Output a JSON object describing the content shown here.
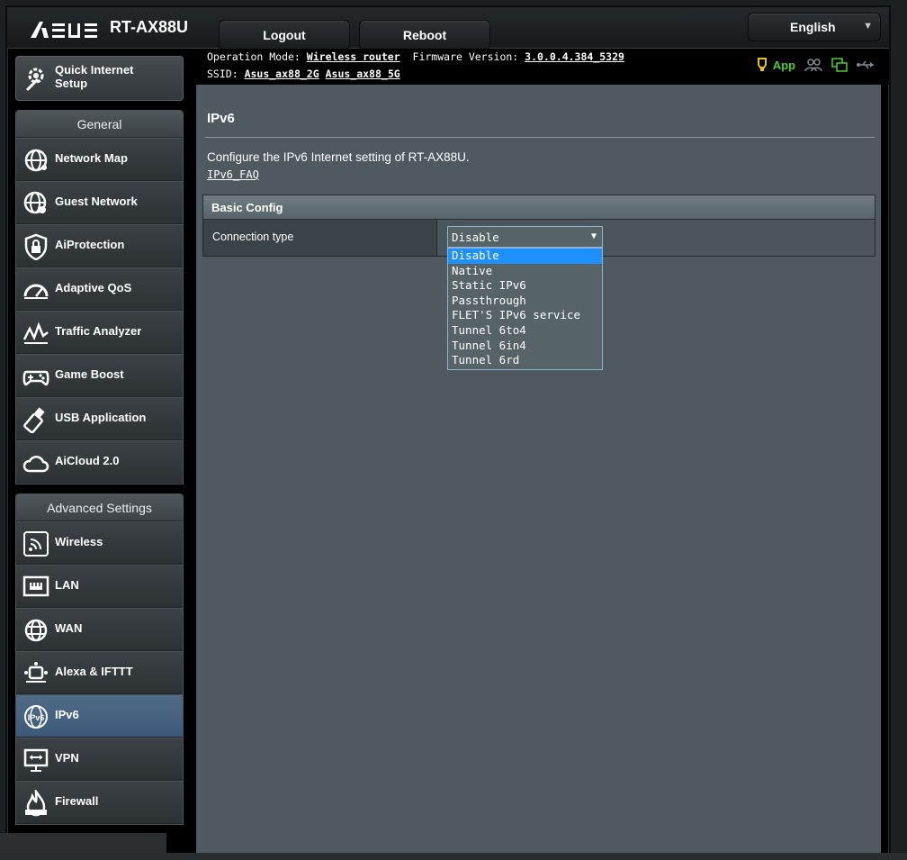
{
  "brand": {
    "logo": "/ISUS",
    "model": "RT-AX88U"
  },
  "header": {
    "logout_label": "Logout",
    "reboot_label": "Reboot",
    "language": "English"
  },
  "info": {
    "operation_mode_label": "Operation Mode:",
    "operation_mode_value": "Wireless router",
    "firmware_label": "Firmware Version:",
    "firmware_value": "3.0.0.4.384_5329",
    "ssid_label": "SSID:",
    "ssid_2g": "Asus_ax88_2G",
    "ssid_5g": "Asus_ax88_5G",
    "app_label": "App"
  },
  "sidebar": {
    "qis_label_line1": "Quick Internet",
    "qis_label_line2": "Setup",
    "general_title": "General",
    "general_items": [
      {
        "label": "Network Map",
        "icon": "globe-network-icon"
      },
      {
        "label": "Guest Network",
        "icon": "guest-globe-icon"
      },
      {
        "label": "AiProtection",
        "icon": "shield-lock-icon"
      },
      {
        "label": "Adaptive QoS",
        "icon": "speedometer-icon"
      },
      {
        "label": "Traffic Analyzer",
        "icon": "traffic-chart-icon"
      },
      {
        "label": "Game Boost",
        "icon": "gamepad-icon"
      },
      {
        "label": "USB Application",
        "icon": "usb-stick-icon"
      },
      {
        "label": "AiCloud 2.0",
        "icon": "cloud-icon"
      }
    ],
    "advanced_title": "Advanced Settings",
    "advanced_items": [
      {
        "label": "Wireless",
        "icon": "wifi-icon"
      },
      {
        "label": "LAN",
        "icon": "lan-icon"
      },
      {
        "label": "WAN",
        "icon": "wan-globe-icon"
      },
      {
        "label": "Alexa & IFTTT",
        "icon": "smart-home-icon"
      },
      {
        "label": "IPv6",
        "icon": "ipv6-globe-icon",
        "active": true
      },
      {
        "label": "VPN",
        "icon": "vpn-monitor-icon"
      },
      {
        "label": "Firewall",
        "icon": "firewall-flame-icon"
      }
    ]
  },
  "main": {
    "title": "IPv6",
    "description": "Configure the IPv6 Internet setting of RT-AX88U.",
    "faq_link": "IPv6_FAQ",
    "section_title": "Basic Config",
    "connection_type_label": "Connection type",
    "connection_type_value": "Disable",
    "connection_type_options": [
      "Disable",
      "Native",
      "Static IPv6",
      "Passthrough",
      "FLET'S IPv6 service",
      "Tunnel 6to4",
      "Tunnel 6in4",
      "Tunnel 6rd"
    ],
    "highlighted_option_index": 0
  },
  "colors": {
    "content_bg": "#4e5a5f",
    "active_menu": "#3c5a78",
    "highlight": "#1e90ff",
    "app_green": "#4ece2a"
  }
}
